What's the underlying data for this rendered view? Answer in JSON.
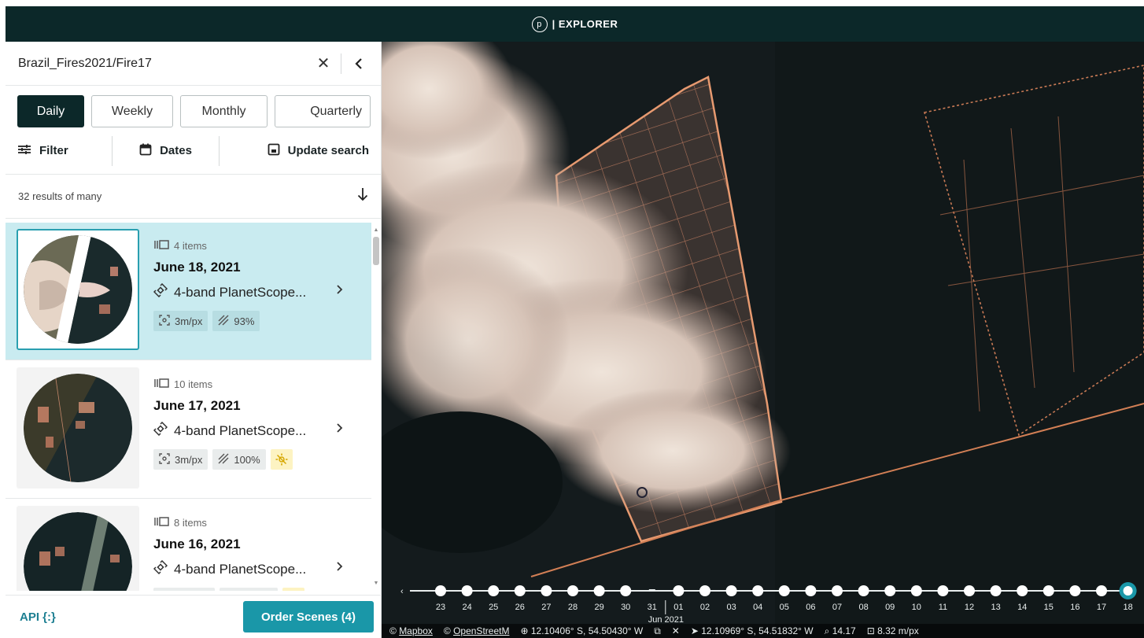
{
  "header": {
    "logo_letter": "p",
    "title": "| EXPLORER"
  },
  "search": {
    "title": "Brazil_Fires2021/Fire17",
    "close_icon": "close-icon",
    "collapse_icon": "chevron-left-icon"
  },
  "tabs": [
    {
      "label": "Daily",
      "active": true
    },
    {
      "label": "Weekly",
      "active": false
    },
    {
      "label": "Monthly",
      "active": false
    },
    {
      "label": "Quarterly",
      "active": false
    }
  ],
  "actions": {
    "filter_label": "Filter",
    "dates_label": "Dates",
    "update_label": "Update search"
  },
  "results": {
    "count_label": "32 results of many"
  },
  "cards": [
    {
      "items": "4 items",
      "date": "June 18, 2021",
      "sensor": "4-band PlanetScope...",
      "resolution": "3m/px",
      "coverage": "93%",
      "selected": true,
      "warning": false
    },
    {
      "items": "10 items",
      "date": "June 17, 2021",
      "sensor": "4-band PlanetScope...",
      "resolution": "3m/px",
      "coverage": "100%",
      "selected": false,
      "warning": true
    },
    {
      "items": "8 items",
      "date": "June 16, 2021",
      "sensor": "4-band PlanetScope...",
      "resolution": "",
      "coverage": "",
      "selected": false,
      "warning": true
    }
  ],
  "footer": {
    "api_label": "API {:}",
    "order_label": "Order Scenes (4)"
  },
  "timeline": {
    "days": [
      "23",
      "24",
      "25",
      "26",
      "27",
      "28",
      "29",
      "30",
      "31",
      "01",
      "02",
      "03",
      "04",
      "05",
      "06",
      "07",
      "08",
      "09",
      "10",
      "11",
      "12",
      "13",
      "14",
      "15",
      "16",
      "17",
      "18"
    ],
    "selected_day": "18",
    "month_label": "Jun 2021"
  },
  "attribution": {
    "mapbox": "Mapbox",
    "osm": "OpenStreetM",
    "cursor_coords": "12.10406° S, 54.50430° W",
    "pin_coords": "12.10969° S, 54.51832° W",
    "zoom": "14.17",
    "resolution": "8.32 m/px"
  },
  "colors": {
    "header_bg": "#0c2829",
    "accent": "#1a97a8",
    "selected_card": "#c9ebf0",
    "fire_outline": "#e08a5a"
  }
}
